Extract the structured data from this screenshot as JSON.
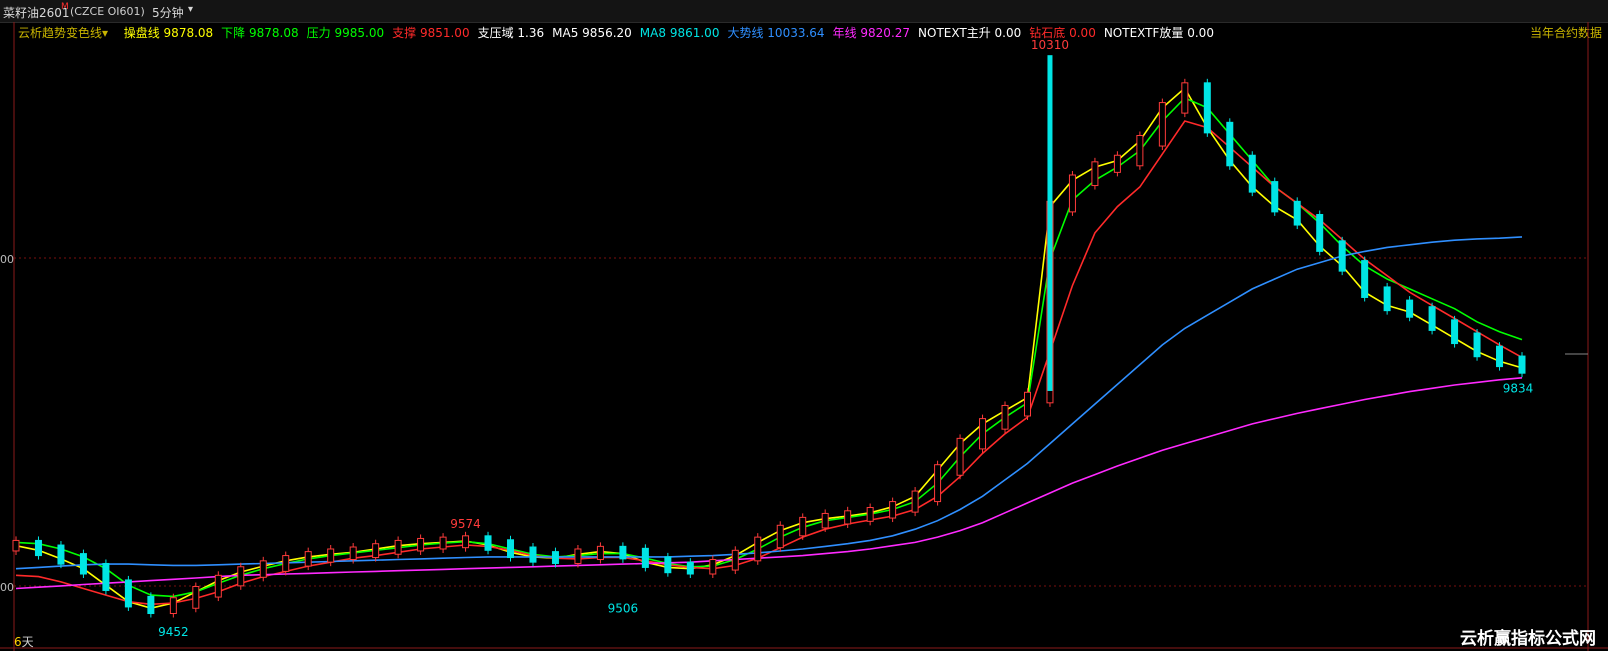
{
  "window": {
    "symbol": "菜籽油2601",
    "symbol_sup": "M",
    "code": "(CZCE OI601)",
    "period": "5分钟",
    "period_caret": "▾"
  },
  "indicator_bar": {
    "name": "云析趋势变色线",
    "name_caret": "▾",
    "items": [
      {
        "label": "操盘线",
        "value": "9878.08",
        "color": "#ffff00"
      },
      {
        "label": "下降",
        "value": "9878.08",
        "color": "#00ff00"
      },
      {
        "label": "压力",
        "value": "9985.00",
        "color": "#00ff00"
      },
      {
        "label": "支撑",
        "value": "9851.00",
        "color": "#ff2a2a"
      },
      {
        "label": "支压域",
        "value": "1.36",
        "color": "#ffffff"
      },
      {
        "label": "MA5",
        "value": "9856.20",
        "color": "#ffffff"
      },
      {
        "label": "MA8",
        "value": "9861.00",
        "color": "#00e5e5"
      },
      {
        "label": "大势线",
        "value": "10033.64",
        "color": "#2f8fff"
      },
      {
        "label": "年线",
        "value": "9820.27",
        "color": "#ff2aff"
      },
      {
        "label": "NOTEXT主升",
        "value": "0.00",
        "color": "#ffffff"
      },
      {
        "label": "钻石底",
        "value": "0.00",
        "color": "#ff2a2a"
      },
      {
        "label": "NOTEXTF放量",
        "value": "0.00",
        "color": "#ffffff"
      }
    ]
  },
  "right_label": "当年合约数据",
  "days_label": {
    "count": "6",
    "unit": "天"
  },
  "axis": {
    "top_label": "00",
    "bottom_label": "00"
  },
  "watermark": "云析赢指标公式网",
  "chart_data": {
    "type": "line",
    "title": "",
    "xlabel": "",
    "ylabel": "",
    "ylim": [
      9440,
      10330
    ],
    "annotations": [
      {
        "text": "10310",
        "value": 10310,
        "kind": "high",
        "color": "#ff3b3b"
      },
      {
        "text": "9574",
        "value": 9574,
        "kind": "high",
        "color": "#ff3b3b"
      },
      {
        "text": "9506",
        "value": 9506,
        "kind": "low",
        "color": "#00e5e5"
      },
      {
        "text": "9452",
        "value": 9452,
        "kind": "low",
        "color": "#00e5e5"
      },
      {
        "text": "9834",
        "value": 9834,
        "kind": "last",
        "color": "#00e5e5"
      }
    ],
    "series": [
      {
        "name": "操盘线",
        "color": "#ffff00",
        "values": [
          9565,
          9558,
          9545,
          9530,
          9505,
          9480,
          9470,
          9478,
          9495,
          9512,
          9525,
          9534,
          9542,
          9548,
          9552,
          9555,
          9560,
          9565,
          9568,
          9570,
          9572,
          9566,
          9555,
          9548,
          9546,
          9552,
          9556,
          9553,
          9540,
          9532,
          9530,
          9536,
          9550,
          9570,
          9588,
          9600,
          9606,
          9610,
          9615,
          9624,
          9640,
          9680,
          9720,
          9750,
          9770,
          9790,
          10080,
          10120,
          10140,
          10150,
          10180,
          10230,
          10260,
          10200,
          10150,
          10110,
          10080,
          10060,
          10020,
          9990,
          9950,
          9930,
          9920,
          9900,
          9880,
          9860,
          9845,
          9835
        ]
      },
      {
        "name": "下降",
        "color": "#00ff00",
        "values": [
          9570,
          9568,
          9560,
          9548,
          9530,
          9505,
          9490,
          9488,
          9495,
          9508,
          9520,
          9530,
          9538,
          9545,
          9550,
          9554,
          9558,
          9562,
          9566,
          9569,
          9571,
          9568,
          9560,
          9552,
          9548,
          9550,
          9553,
          9553,
          9546,
          9538,
          9533,
          9534,
          9544,
          9560,
          9578,
          9593,
          9603,
          9608,
          9613,
          9620,
          9632,
          9660,
          9700,
          9735,
          9760,
          9782,
          10000,
          10090,
          10120,
          10140,
          10165,
          10210,
          10245,
          10230,
          10190,
          10150,
          10110,
          10085,
          10055,
          10020,
          9990,
          9970,
          9955,
          9940,
          9925,
          9905,
          9890,
          9878
        ]
      },
      {
        "name": "支撑",
        "color": "#ff2a2a",
        "values": [
          9520,
          9518,
          9510,
          9500,
          9490,
          9480,
          9476,
          9478,
          9485,
          9495,
          9508,
          9518,
          9526,
          9534,
          9540,
          9546,
          9550,
          9555,
          9560,
          9563,
          9566,
          9564,
          9558,
          9550,
          9546,
          9545,
          9547,
          9547,
          9542,
          9536,
          9532,
          9530,
          9535,
          9546,
          9562,
          9578,
          9590,
          9598,
          9604,
          9610,
          9620,
          9640,
          9670,
          9705,
          9735,
          9760,
          9860,
          9960,
          10040,
          10080,
          10110,
          10160,
          10210,
          10200,
          10170,
          10140,
          10110,
          10085,
          10060,
          10030,
          10000,
          9975,
          9950,
          9930,
          9910,
          9890,
          9870,
          9851
        ]
      },
      {
        "name": "大势线",
        "color": "#2f8fff",
        "values": [
          9530,
          9532,
          9534,
          9536,
          9537,
          9537,
          9536,
          9535,
          9535,
          9536,
          9537,
          9538,
          9539,
          9540,
          9541,
          9542,
          9543,
          9544,
          9545,
          9546,
          9547,
          9548,
          9548,
          9548,
          9548,
          9548,
          9548,
          9548,
          9548,
          9548,
          9549,
          9550,
          9552,
          9554,
          9557,
          9560,
          9564,
          9568,
          9573,
          9580,
          9590,
          9603,
          9620,
          9640,
          9665,
          9690,
          9720,
          9750,
          9780,
          9810,
          9840,
          9870,
          9895,
          9915,
          9935,
          9955,
          9970,
          9985,
          9995,
          10005,
          10012,
          10018,
          10022,
          10026,
          10029,
          10031,
          10032,
          10034
        ]
      },
      {
        "name": "年线",
        "color": "#ff2aff",
        "values": [
          9500,
          9502,
          9504,
          9506,
          9508,
          9510,
          9512,
          9514,
          9516,
          9518,
          9520,
          9521,
          9522,
          9523,
          9524,
          9525,
          9526,
          9527,
          9528,
          9529,
          9530,
          9531,
          9532,
          9533,
          9534,
          9535,
          9536,
          9537,
          9538,
          9539,
          9540,
          9542,
          9544,
          9546,
          9548,
          9550,
          9553,
          9556,
          9560,
          9565,
          9570,
          9578,
          9588,
          9600,
          9615,
          9630,
          9645,
          9660,
          9673,
          9686,
          9698,
          9710,
          9720,
          9730,
          9740,
          9750,
          9758,
          9766,
          9773,
          9780,
          9787,
          9793,
          9799,
          9804,
          9809,
          9813,
          9817,
          9820
        ]
      }
    ]
  }
}
